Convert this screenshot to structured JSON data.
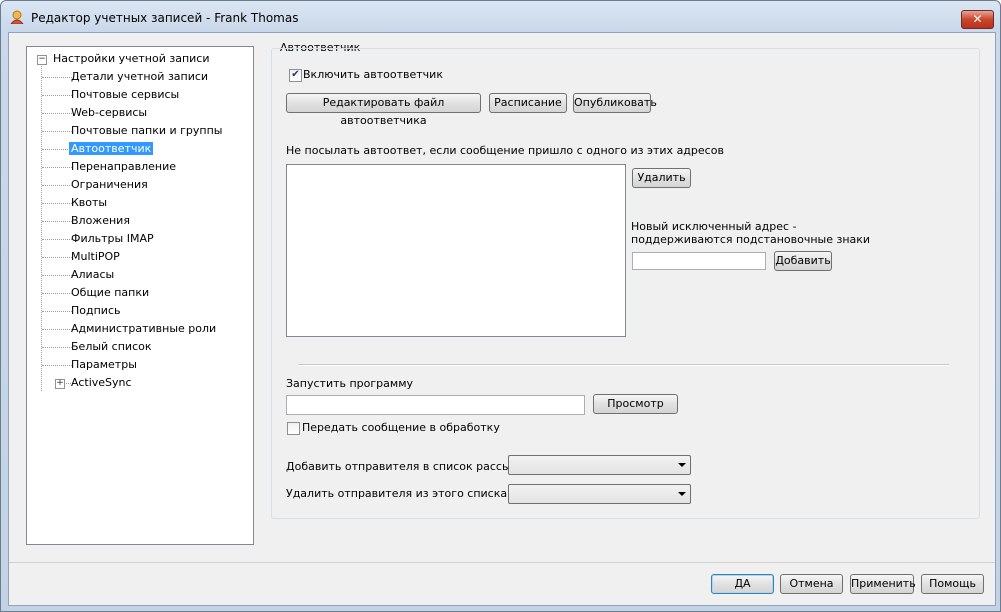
{
  "window": {
    "title": "Редактор учетных записей - Frank Thomas",
    "close_label": "✕"
  },
  "tree": {
    "root_label": "Настройки учетной записи",
    "items": [
      {
        "label": "Детали учетной записи"
      },
      {
        "label": "Почтовые сервисы"
      },
      {
        "label": "Web-сервисы"
      },
      {
        "label": "Почтовые папки и группы"
      },
      {
        "label": "Автоответчик",
        "selected": true
      },
      {
        "label": "Перенаправление"
      },
      {
        "label": "Ограничения"
      },
      {
        "label": "Квоты"
      },
      {
        "label": "Вложения"
      },
      {
        "label": "Фильтры IMAP"
      },
      {
        "label": "MultiPOP"
      },
      {
        "label": "Алиасы"
      },
      {
        "label": "Общие папки"
      },
      {
        "label": "Подпись"
      },
      {
        "label": "Административные роли"
      },
      {
        "label": "Белый список"
      },
      {
        "label": "Параметры"
      },
      {
        "label": "ActiveSync",
        "expandable": true
      }
    ]
  },
  "panel": {
    "title": "Автоответчик",
    "enable_label": "Включить автоответчик",
    "enable_checked": true,
    "edit_file_button": "Редактировать файл автоответчика",
    "schedule_button": "Расписание",
    "publish_button": "Опубликовать",
    "exclusion_label": "Не посылать автоответ, если сообщение пришло с одного из этих адресов",
    "remove_button": "Удалить",
    "new_address_label_1": "Новый исключенный адрес  -",
    "new_address_label_2": "поддерживаются подстановочные знаки",
    "new_address_value": "",
    "add_button": "Добавить",
    "run_program_label": "Запустить программу",
    "run_program_value": "",
    "browse_button": "Просмотр",
    "pass_message_label": "Передать сообщение в обработку",
    "pass_message_checked": false,
    "add_sender_label": "Добавить отправителя в список рассылок",
    "add_sender_value": "",
    "remove_sender_label": "Удалить отправителя из этого списка",
    "remove_sender_value": ""
  },
  "footer": {
    "ok_button": "ДА",
    "cancel_button": "Отмена",
    "apply_button": "Применить",
    "help_button": "Помощь"
  },
  "colors": {
    "selection": "#3399ff",
    "close_button": "#c9452c"
  }
}
